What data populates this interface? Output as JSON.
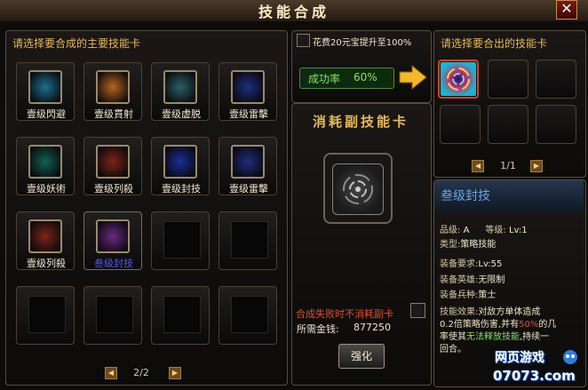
{
  "window": {
    "title": "技能合成",
    "close_label": "✕"
  },
  "left_panel": {
    "title": "请选择要合成的主要技能卡",
    "slots": [
      {
        "label": "壹级閃避",
        "icon": "dodge-icon",
        "color": "#1c6f8f"
      },
      {
        "label": "壹级貫射",
        "icon": "pierce-shot-icon",
        "color": "#b7641f"
      },
      {
        "label": "壹级虚脱",
        "icon": "exhaust-icon",
        "color": "#2b5f67"
      },
      {
        "label": "壹级雷擊",
        "icon": "lightning-icon",
        "color": "#1f2d7a"
      },
      {
        "label": "壹级妖術",
        "icon": "sorcery-icon",
        "color": "#136052"
      },
      {
        "label": "壹级列殺",
        "icon": "slaughter-icon",
        "color": "#7e2417"
      },
      {
        "label": "壹级封技",
        "icon": "seal-skill-icon",
        "color": "#1a2d98"
      },
      {
        "label": "壹级雷擊",
        "icon": "lightning-icon",
        "color": "#1f2d7a"
      },
      {
        "label": "壹级列殺",
        "icon": "slaughter-icon",
        "color": "#7e2417"
      },
      {
        "label": "叁级封技",
        "icon": "seal-skill-rainbow-icon",
        "color": "#6a2a82"
      }
    ],
    "page": "2/2",
    "prev": "◀",
    "next": "▶"
  },
  "upgrade": {
    "label": "花费20元宝提升至100%",
    "success_label": "成功率",
    "success_value": "60%"
  },
  "consume": {
    "title": "消耗副技能卡",
    "keep_label": "合成失败时不消耗副卡",
    "cost_label": "所需金钱:",
    "cost_value": "877250",
    "button": "强化"
  },
  "right_panel": {
    "title": "请选择要合出的技能卡",
    "page": "1/1",
    "prev": "◀",
    "next": "▶"
  },
  "info": {
    "skill_name": "叁级封技",
    "grade_label": "品级:",
    "grade_value": "A",
    "level_label": "等级:",
    "level_value": "Lv:1",
    "type_label": "类型:",
    "type_value": "策略技能",
    "req_label": "装备要求:",
    "req_value": "Lv:55",
    "hero_label": "装备英雄:",
    "hero_value": "无限制",
    "unit_label": "装备兵种:",
    "unit_value": "策士",
    "effect_label": "技能效果:",
    "effect_1": "对敌方单体造成",
    "effect_2a": "0.2倍策略伤害,并有",
    "effect_pct": "50%",
    "effect_2b": "的几",
    "effect_3a": "率使其",
    "effect_3b": "无法释放技能",
    "effect_3c": ",持续一",
    "effect_4": "回合。"
  },
  "watermark": {
    "top": "网页游戏",
    "bottom": "07073.com"
  },
  "colors": {
    "accent": "#e7ba55",
    "success_green": "#86e36a",
    "border": "#5a4b37"
  }
}
